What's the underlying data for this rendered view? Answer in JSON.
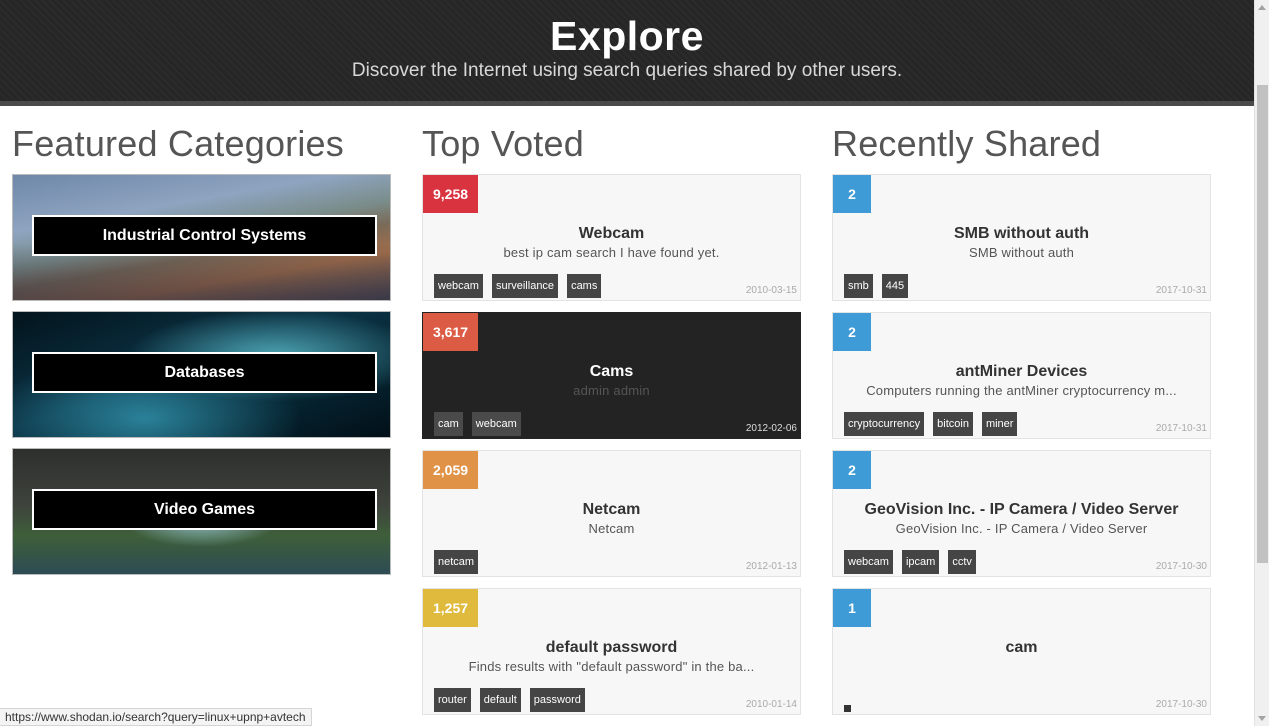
{
  "header": {
    "title": "Explore",
    "subtitle": "Discover the Internet using search queries shared by other users."
  },
  "featured": {
    "heading": "Featured Categories",
    "items": [
      {
        "label": "Industrial Control Systems"
      },
      {
        "label": "Databases"
      },
      {
        "label": "Video Games"
      }
    ]
  },
  "top_voted": {
    "heading": "Top Voted",
    "cards": [
      {
        "votes": "9,258",
        "color": "#d9333f",
        "title": "Webcam",
        "desc": "best ip cam search I have found yet.",
        "tags": [
          "webcam",
          "surveillance",
          "cams"
        ],
        "date": "2010-03-15"
      },
      {
        "votes": "3,617",
        "color": "#dc5b44",
        "title": "Cams",
        "desc": "admin admin",
        "tags": [
          "cam",
          "webcam"
        ],
        "date": "2012-02-06"
      },
      {
        "votes": "2,059",
        "color": "#e09347",
        "title": "Netcam",
        "desc": "Netcam",
        "tags": [
          "netcam"
        ],
        "date": "2012-01-13"
      },
      {
        "votes": "1,257",
        "color": "#dfba3d",
        "title": "default password",
        "desc": "Finds results with \"default password\" in the ba...",
        "tags": [
          "router",
          "default",
          "password"
        ],
        "date": "2010-01-14"
      }
    ]
  },
  "recent": {
    "heading": "Recently Shared",
    "cards": [
      {
        "votes": "2",
        "color": "#3e9bd6",
        "title": "SMB without auth",
        "desc": "SMB without auth",
        "tags": [
          "smb",
          "445"
        ],
        "date": "2017-10-31"
      },
      {
        "votes": "2",
        "color": "#3e9bd6",
        "title": "antMiner Devices",
        "desc": "Computers running the antMiner cryptocurrency m...",
        "tags": [
          "cryptocurrency",
          "bitcoin",
          "miner"
        ],
        "date": "2017-10-31"
      },
      {
        "votes": "2",
        "color": "#3e9bd6",
        "title": "GeoVision Inc. - IP Camera / Video Server",
        "desc": "GeoVision Inc. - IP Camera / Video Server",
        "tags": [
          "webcam",
          "ipcam",
          "cctv"
        ],
        "date": "2017-10-30"
      },
      {
        "votes": "1",
        "color": "#3e9bd6",
        "title": "cam",
        "desc": "",
        "tags": [],
        "date": "2017-10-30"
      }
    ]
  },
  "statusbar": {
    "url": "https://www.shodan.io/search?query=linux+upnp+avtech"
  }
}
